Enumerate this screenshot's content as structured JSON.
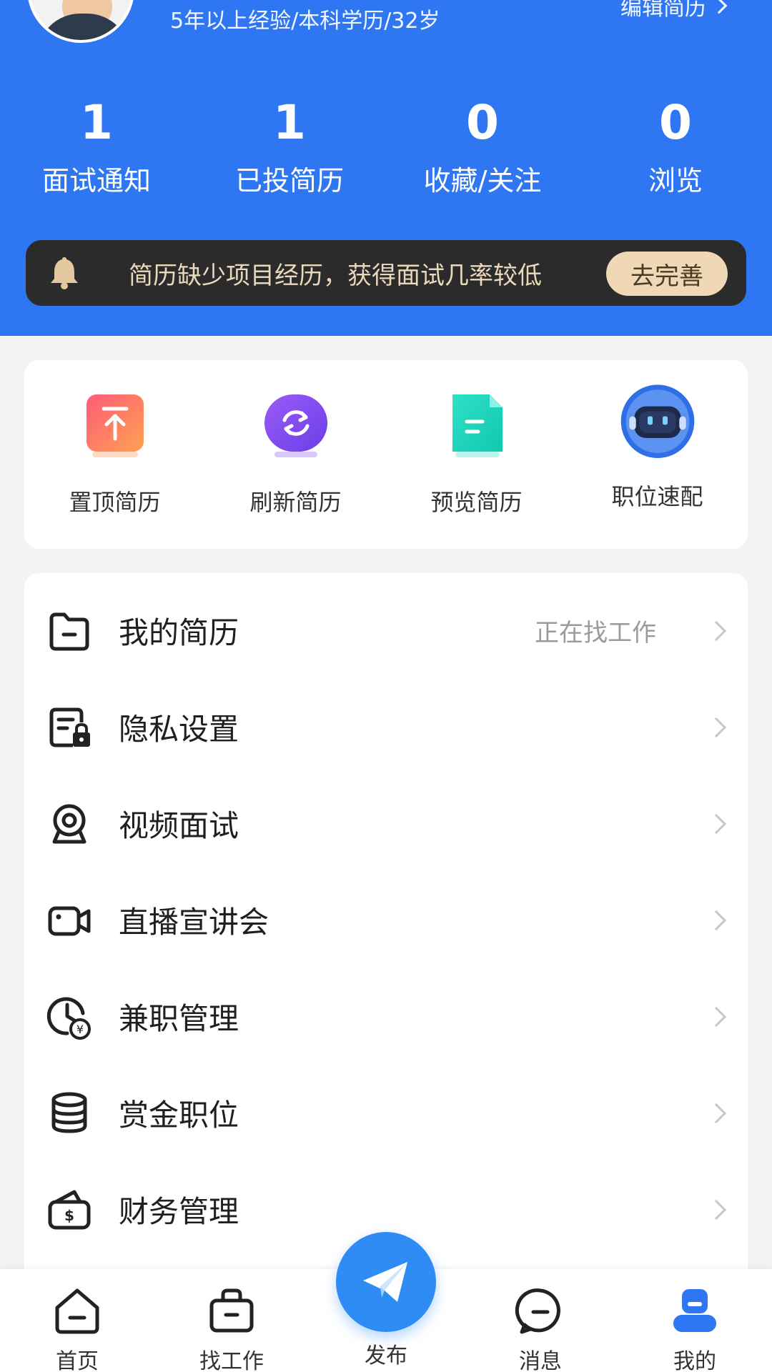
{
  "header": {
    "user_meta": "5年以上经验/本科学历/32岁",
    "edit_resume": "编辑简历",
    "stats": [
      {
        "value": "1",
        "label": "面试通知"
      },
      {
        "value": "1",
        "label": "已投简历"
      },
      {
        "value": "0",
        "label": "收藏/关注"
      },
      {
        "value": "0",
        "label": "浏览"
      }
    ],
    "notice": {
      "text": "简历缺少项目经历，获得面试几率较低",
      "button": "去完善"
    }
  },
  "tools": [
    {
      "label": "置顶简历",
      "icon": "pin-top-icon"
    },
    {
      "label": "刷新简历",
      "icon": "refresh-icon"
    },
    {
      "label": "预览简历",
      "icon": "document-preview-icon"
    },
    {
      "label": "职位速配",
      "icon": "robot-icon"
    }
  ],
  "menu": [
    {
      "label": "我的简历",
      "status": "正在找工作",
      "icon": "folder-icon"
    },
    {
      "label": "隐私设置",
      "status": "",
      "icon": "privacy-lock-icon"
    },
    {
      "label": "视频面试",
      "status": "",
      "icon": "webcam-icon"
    },
    {
      "label": "直播宣讲会",
      "status": "",
      "icon": "video-camera-icon"
    },
    {
      "label": "兼职管理",
      "status": "",
      "icon": "clock-yen-icon"
    },
    {
      "label": "赏金职位",
      "status": "",
      "icon": "coin-stack-icon"
    },
    {
      "label": "财务管理",
      "status": "",
      "icon": "wallet-icon"
    }
  ],
  "bottom_nav": {
    "items": [
      {
        "label": "首页",
        "icon": "home-icon"
      },
      {
        "label": "找工作",
        "icon": "briefcase-icon"
      },
      {
        "label": "发布",
        "icon": "paper-plane-icon"
      },
      {
        "label": "消息",
        "icon": "chat-icon"
      },
      {
        "label": "我的",
        "icon": "profile-icon"
      }
    ],
    "active": "我的"
  },
  "colors": {
    "primary": "#2f77f2",
    "notice_bg": "#2b2b2b",
    "notice_text": "#ead8bd",
    "notice_button": "#f0d7b6",
    "publish_button": "#2f8cf5"
  }
}
